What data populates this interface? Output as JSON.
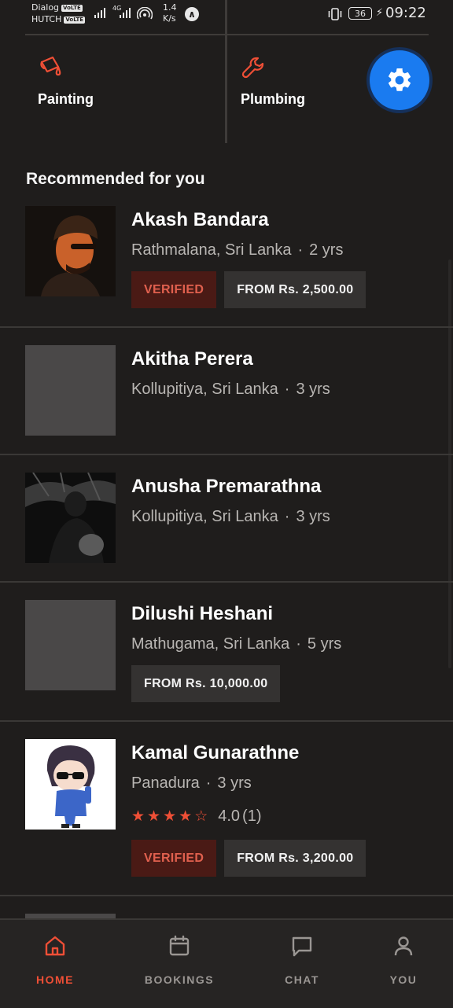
{
  "status_bar": {
    "carrier1": "Dialog",
    "carrier2": "HUTCH",
    "volte": "VoLTE",
    "network": "4G",
    "speed_value": "1.4",
    "speed_unit": "K/s",
    "battery": "36",
    "time": "09:22"
  },
  "categories": [
    {
      "label": "Painting",
      "icon": "paint-bucket-icon"
    },
    {
      "label": "Plumbing",
      "icon": "wrench-icon"
    }
  ],
  "fab_icon": "gear-icon",
  "section_title": "Recommended for you",
  "providers": [
    {
      "name": "Akash Bandara",
      "location": "Rathmalana, Sri Lanka",
      "experience": "2 yrs",
      "verified": "VERIFIED",
      "price": "FROM Rs. 2,500.00"
    },
    {
      "name": "Akitha Perera",
      "location": "Kollupitiya, Sri Lanka",
      "experience": "3 yrs"
    },
    {
      "name": "Anusha Premarathna",
      "location": "Kollupitiya, Sri Lanka",
      "experience": "3 yrs"
    },
    {
      "name": "Dilushi Heshani",
      "location": "Mathugama, Sri Lanka",
      "experience": "5 yrs",
      "price": "FROM Rs. 10,000.00"
    },
    {
      "name": "Kamal Gunarathne",
      "location": "Panadura",
      "experience": "3 yrs",
      "rating": "4.0",
      "rating_stars": 4,
      "rating_count": "(1)",
      "verified": "VERIFIED",
      "price": "FROM Rs. 3,200.00"
    }
  ],
  "meta_separator": "·",
  "bottom_nav": [
    {
      "label": "HOME",
      "icon": "home-icon",
      "active": true
    },
    {
      "label": "BOOKINGS",
      "icon": "calendar-icon",
      "active": false
    },
    {
      "label": "CHAT",
      "icon": "chat-icon",
      "active": false
    },
    {
      "label": "YOU",
      "icon": "user-icon",
      "active": false
    }
  ],
  "colors": {
    "background": "#1f1d1c",
    "accent": "#ef4f36",
    "fab": "#1a7bf0",
    "verified_bg": "#4a1a15",
    "price_bg": "#343231"
  }
}
